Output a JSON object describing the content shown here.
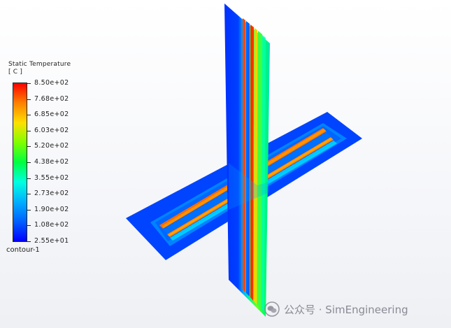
{
  "legend": {
    "title": "Static Temperature",
    "unit": "[ C ]",
    "labels": [
      "8.50e+02",
      "7.68e+02",
      "6.85e+02",
      "6.03e+02",
      "5.20e+02",
      "4.38e+02",
      "3.55e+02",
      "2.73e+02",
      "1.90e+02",
      "1.08e+02",
      "2.55e+01"
    ],
    "min": 25.5,
    "max": 850,
    "colormap": [
      "#0000ff",
      "#0060ff",
      "#00b0ff",
      "#00ffe0",
      "#00ff40",
      "#80ff00",
      "#ffe000",
      "#ff8000",
      "#ff0000"
    ]
  },
  "contour_name": "contour-1",
  "watermark": {
    "label": "公众号 · SimEngineering",
    "icon": "wechat-icon"
  }
}
